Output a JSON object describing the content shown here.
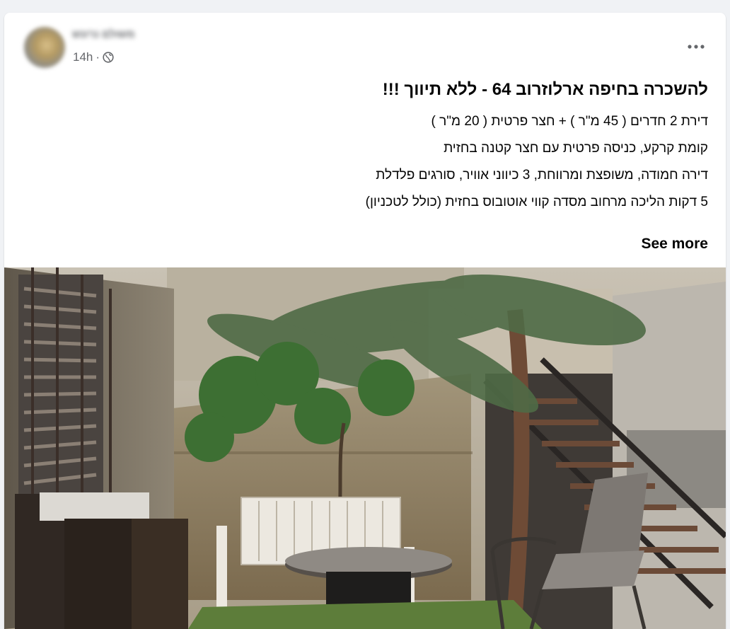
{
  "post": {
    "author": "משולם נרונש",
    "timestamp": "14h",
    "privacy_icon": "globe-icon",
    "more_icon": "more-horizontal-icon",
    "title": "להשכרה בחיפה ארלוזרוב 64 - ללא תיווך !!!",
    "lines": [
      "דירת 2 חדרים ( 45 מ\"ר ) + חצר פרטית ( 20 מ\"ר )",
      "קומת קרקע, כניסה פרטית עם חצר קטנה בחזית",
      "דירה חמודה, משופצת ומרווחת, 3 כיווני אוויר, סורגים פלדלת",
      "5 דקות הליכה מרחוב מסדה קווי אוטובוס בחזית (כולל לטכניון)"
    ],
    "see_more": "See more"
  },
  "colors": {
    "background": "#f0f2f5",
    "card": "#ffffff",
    "secondary_text": "#65676b",
    "primary_text": "#050505"
  }
}
